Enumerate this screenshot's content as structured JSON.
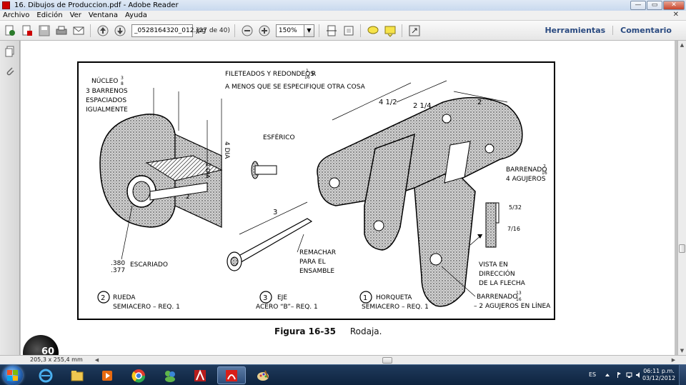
{
  "window": {
    "title": "16. Dibujos de Produccion.pdf - Adobe Reader",
    "controls": {
      "minimize": "—",
      "maximize": "▭",
      "close": "✕"
    }
  },
  "menu": {
    "items": [
      "Archivo",
      "Edición",
      "Ver",
      "Ventana",
      "Ayuda"
    ],
    "close_doc": "✕"
  },
  "toolbar": {
    "page_name": "_0528164320_012.jpg",
    "page_count": "(27 de 40)",
    "zoom": "150%",
    "zoom_drop": "▼",
    "links": {
      "tools": "Herramientas",
      "comment": "Comentario"
    }
  },
  "document": {
    "header_line1": "FILETEADOS Y REDONDEOS",
    "header_frac_num": "1",
    "header_frac_den": "16",
    "header_suffix": "R",
    "header_line2": "A MENOS QUE SE ESPECIFIQUE OTRA COSA",
    "labels": {
      "nucleo": "NÚCLEO",
      "nucleo_frac_num": "3",
      "nucleo_frac_den": "8",
      "barrenos_1": "3 BARRENOS",
      "barrenos_2": "ESPACIADOS",
      "barrenos_3": "IGUALMENTE",
      "esferico": "ESFÉRICO",
      "remachar_1": "REMACHAR",
      "remachar_2": "PARA EL",
      "remachar_3": "ENSAMBLE",
      "escariado_top": ".380",
      "escariado_bot": ".377",
      "escariado": "ESCARIADO",
      "barrenado_top_1": "BARRENADO",
      "barrenado_top_num": "7",
      "barrenado_top_den": "16",
      "barrenado_top_2": "4 AGUJEROS",
      "vista_1": "VISTA EN",
      "vista_2": "DIRECCIÓN",
      "vista_3": "DE LA FLECHA",
      "barrenado_bot_1": "BARRENADO",
      "barrenado_bot_num": "13",
      "barrenado_bot_den": "16",
      "barrenado_bot_2": "– 2 AGUJEROS EN LÍNEA",
      "dim_da4": "4 DIA",
      "dim_da2": "2 DIA",
      "dim_3": "3",
      "dim_2": "2",
      "dim_42": "4 1/2",
      "dim_24": "2 1/4",
      "dim_132": "5/32",
      "dim_716": "7/16"
    },
    "parts": [
      {
        "num": "2",
        "name": "RUEDA",
        "spec": "SEMIACERO – REQ. 1"
      },
      {
        "num": "3",
        "name": "EJE",
        "spec": "ACERO “B”– REQ. 1"
      },
      {
        "num": "1",
        "name": "HORQUETA",
        "spec": "SEMIACERO – REQ. 1"
      }
    ],
    "caption": {
      "figure": "Figura 16-35",
      "title": "Rodaja."
    },
    "logo_text": "60"
  },
  "status": {
    "page_size": "205,3 x 255,4 mm"
  },
  "taskbar": {
    "language": "ES",
    "time": "06:11 p.m.",
    "date": "03/12/2012"
  },
  "colors": {
    "link": "#2a4a80",
    "taskbar": "#1f3a5c",
    "close": "#c8452c"
  }
}
